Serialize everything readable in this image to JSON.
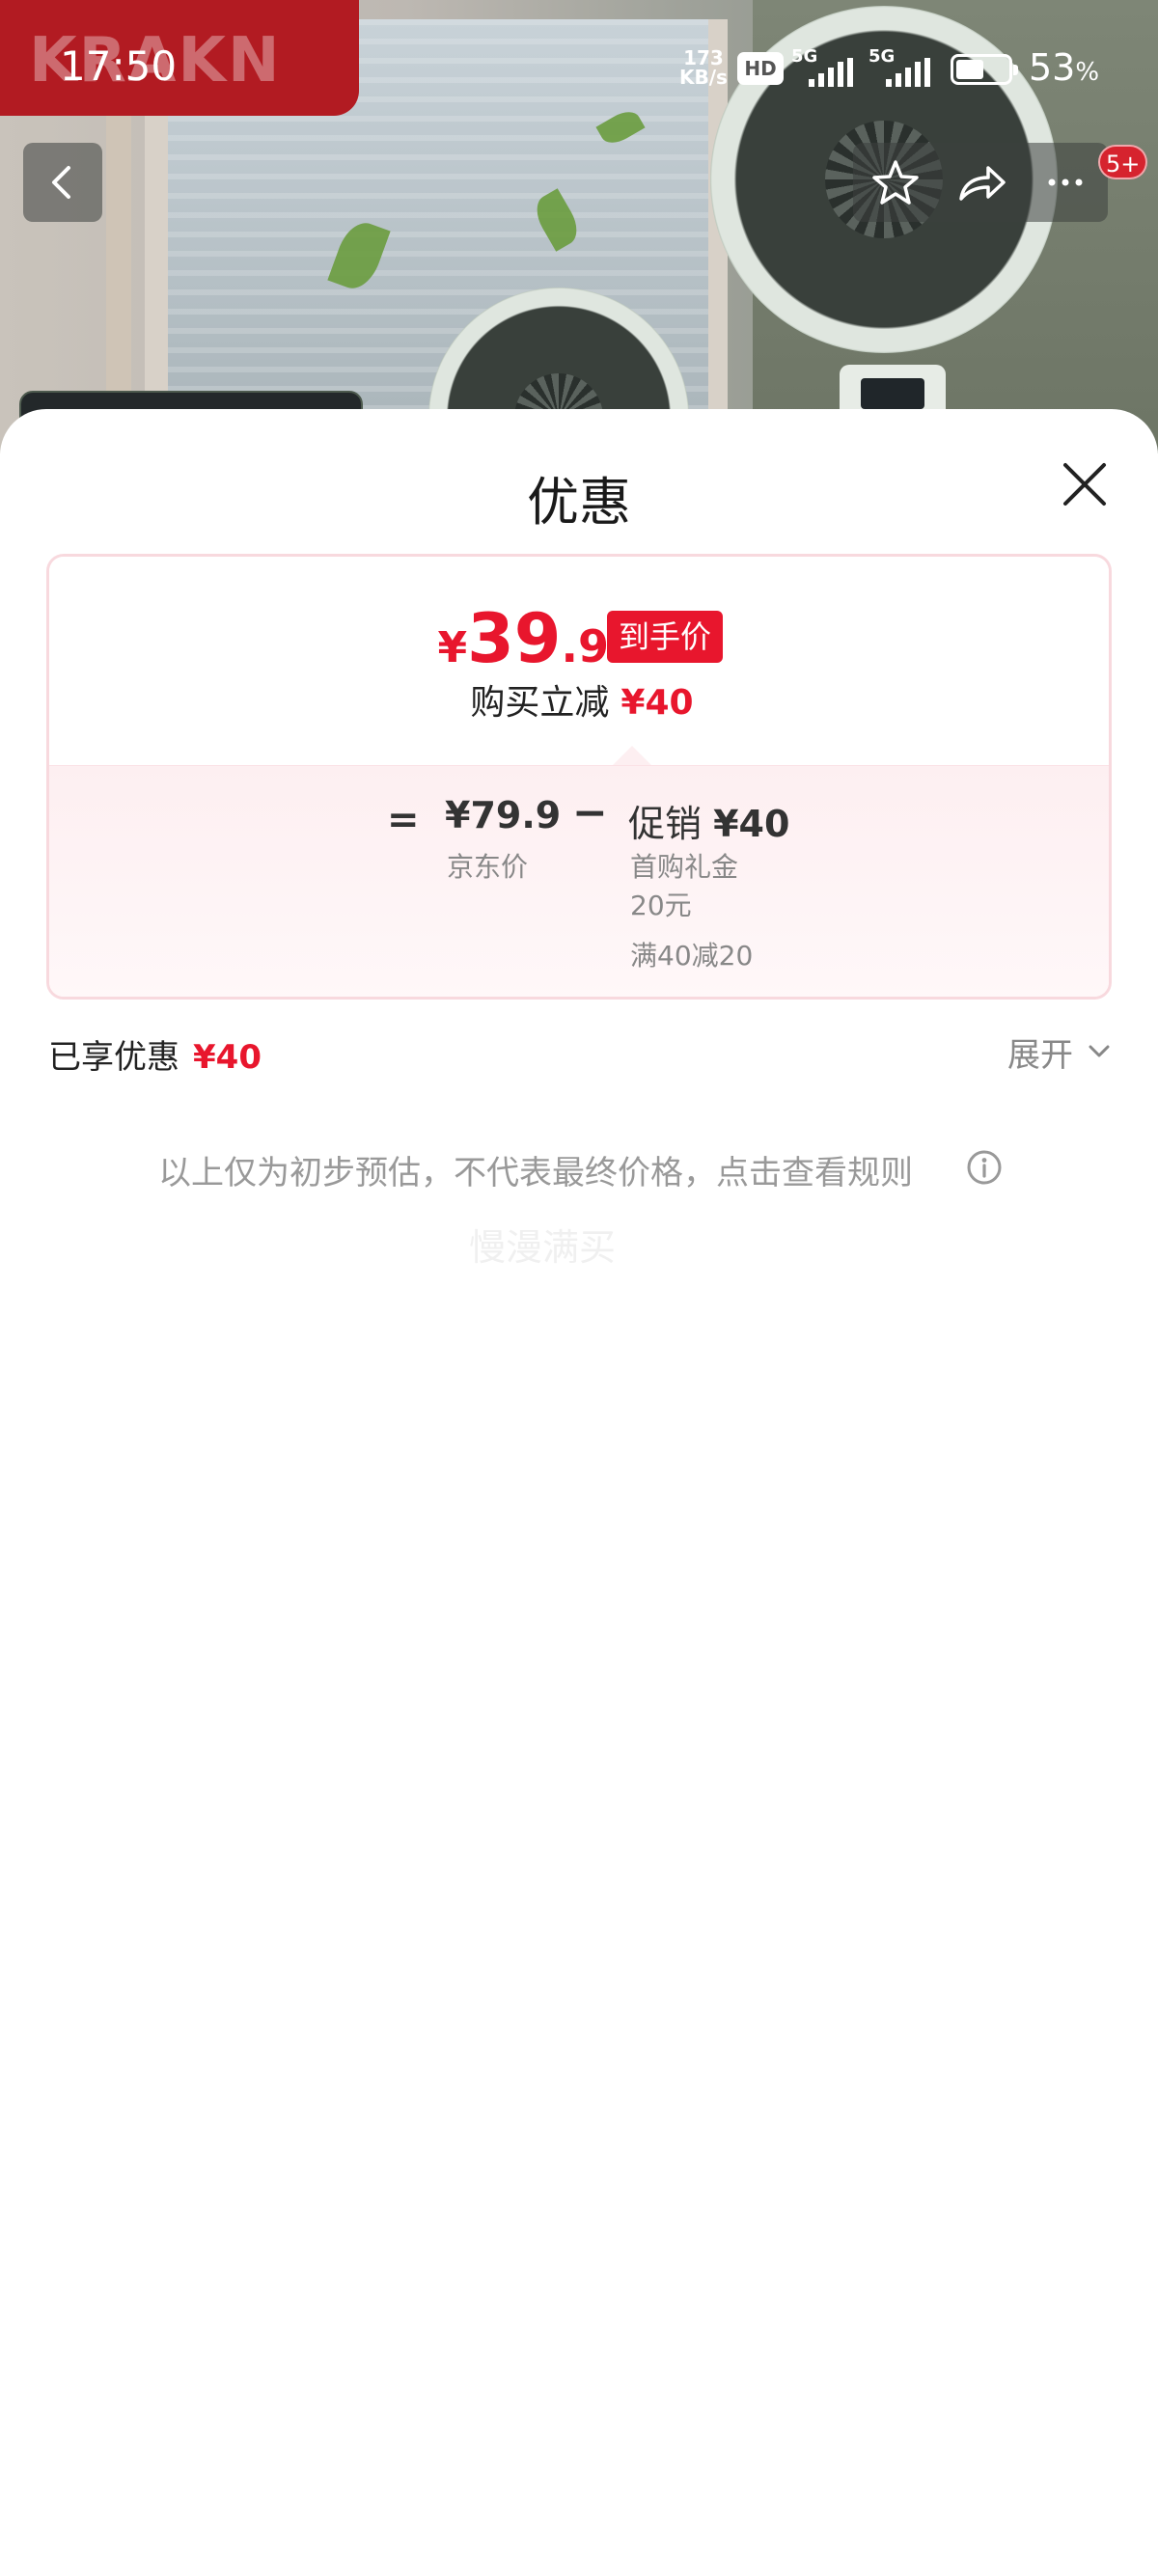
{
  "status_bar": {
    "time": "17:50",
    "net_speed_value": "173",
    "net_speed_unit": "KB/s",
    "hd_label": "HD",
    "signal1_label": "5G",
    "signal2_label": "5G",
    "battery_level_percent": 53,
    "battery_text": "53"
  },
  "background": {
    "brand_text": "KRAKN"
  },
  "nav": {
    "notification_badge": "5+"
  },
  "sheet": {
    "title": "优惠",
    "price_card": {
      "currency": "¥",
      "price_integer": "39",
      "price_decimal": ".9",
      "final_price_tag": "到手价",
      "reduce_label": "购买立减",
      "reduce_amount": "¥40",
      "equals_sign": "=",
      "jd_price": "¥79.9",
      "jd_price_label": "京东价",
      "minus_sign": "−",
      "promo_label": "促销",
      "promo_amount": "¥40",
      "promo_detail_line1": "首购礼金",
      "promo_detail_line2": "20元",
      "promo_detail_line3": "满40减20"
    },
    "enjoyed_label": "已享优惠",
    "enjoyed_amount": "¥40",
    "expand_label": "展开",
    "disclaimer": "以上仅为初步预估，不代表最终价格，点击查看规则",
    "watermark": "慢漫满买"
  },
  "colors": {
    "accent_red": "#e8162d",
    "card_border": "#f8d9de",
    "muted_text": "#888888"
  },
  "icons": [
    "back-arrow-icon",
    "star-icon",
    "share-icon",
    "more-icon",
    "close-icon",
    "chevron-down-icon",
    "info-icon",
    "battery-icon",
    "signal-icon"
  ]
}
